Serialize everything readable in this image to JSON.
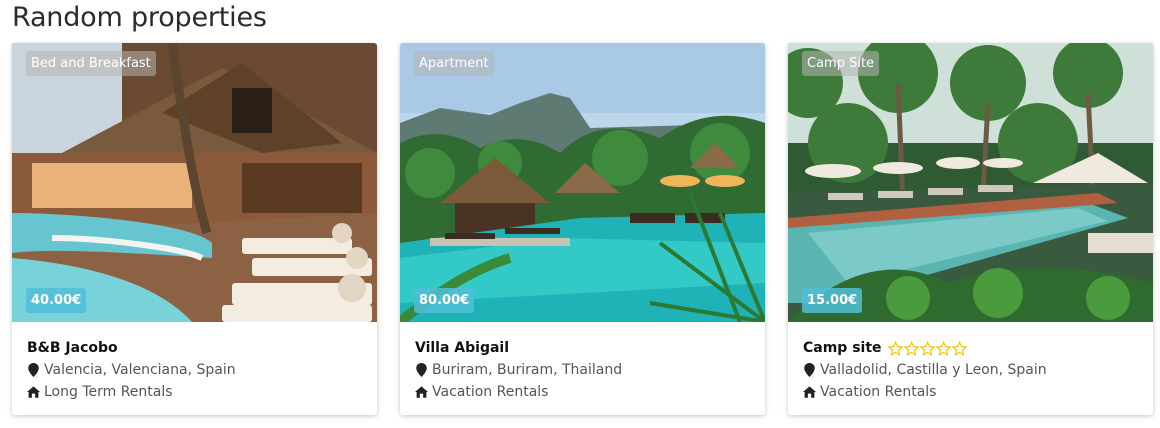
{
  "section": {
    "title": "Random properties"
  },
  "colors": {
    "price_badge": "#50bed7",
    "star": "#f1c40f"
  },
  "cards": [
    {
      "type": "Bed and Breakfast",
      "price": "40.00€",
      "name": "B&B Jacobo",
      "location": "Valencia, Valenciana, Spain",
      "category": "Long Term Rentals",
      "rating": null,
      "photo": "resort-lounge-pool"
    },
    {
      "type": "Apartment",
      "price": "80.00€",
      "name": "Villa Abigail",
      "location": "Buriram, Buriram, Thailand",
      "category": "Vacation Rentals",
      "rating": null,
      "photo": "tropical-pool-mountains"
    },
    {
      "type": "Camp Site",
      "price": "15.00€",
      "name": "Camp site",
      "location": "Valladolid, Castilla y Leon, Spain",
      "category": "Vacation Rentals",
      "rating": {
        "filled": 0,
        "max": 5
      },
      "photo": "jungle-pool-umbrellas"
    }
  ],
  "icons": {
    "location": "map-marker-icon",
    "category": "home-icon",
    "rating": "star-outline-icon"
  }
}
